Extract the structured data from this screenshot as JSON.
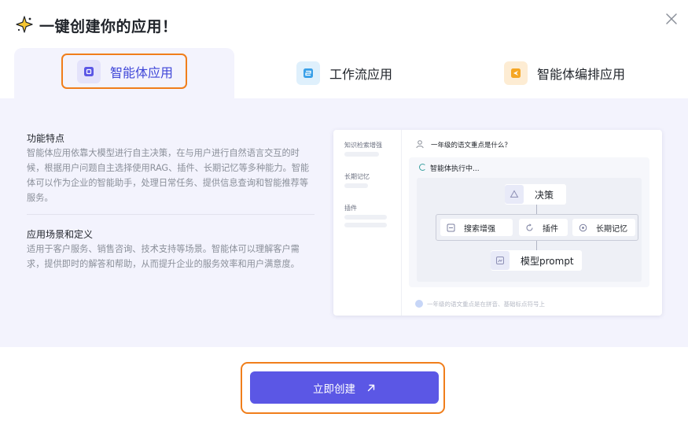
{
  "dialog": {
    "title": "一键创建你的应用！"
  },
  "tabs": [
    {
      "label": "智能体应用",
      "active": true,
      "icon": "agent-app-icon",
      "accent": "#5b57e5"
    },
    {
      "label": "工作流应用",
      "active": false,
      "icon": "workflow-app-icon",
      "accent": "#3aa0e8"
    },
    {
      "label": "智能体编排应用",
      "active": false,
      "icon": "orchestration-app-icon",
      "accent": "#f5a623"
    }
  ],
  "features": {
    "title": "功能特点",
    "text": "智能体应用依靠大模型进行自主决策，在与用户进行自然语言交互的时候，根据用户问题自主选择使用RAG、插件、长期记忆等多种能力。智能体可以作为企业的智能助手，处理日常任务、提供信息查询和智能推荐等服务。"
  },
  "scenarios": {
    "title": "应用场景和定义",
    "text": "适用于客户服务、销售咨询、技术支持等场景。智能体可以理解客户需求，提供即时的解答和帮助，从而提升企业的服务效率和用户满意度。"
  },
  "preview": {
    "sidebar": [
      "知识检索增强",
      "长期记忆",
      "插件"
    ],
    "question": "一年级的语文重点是什么？",
    "exec_label": "智能体执行中...",
    "nodes": {
      "decision": "决策",
      "search": "搜索增强",
      "plugin": "插件",
      "memory": "长期记忆",
      "model": "模型prompt"
    },
    "footer": "一年级的语文重点是在拼音、基础标点符号上"
  },
  "create_button": {
    "label": "立即创建"
  },
  "colors": {
    "primary": "#5b57e5",
    "highlight": "#f07e1b",
    "panel_bg": "#f3f3fd"
  }
}
